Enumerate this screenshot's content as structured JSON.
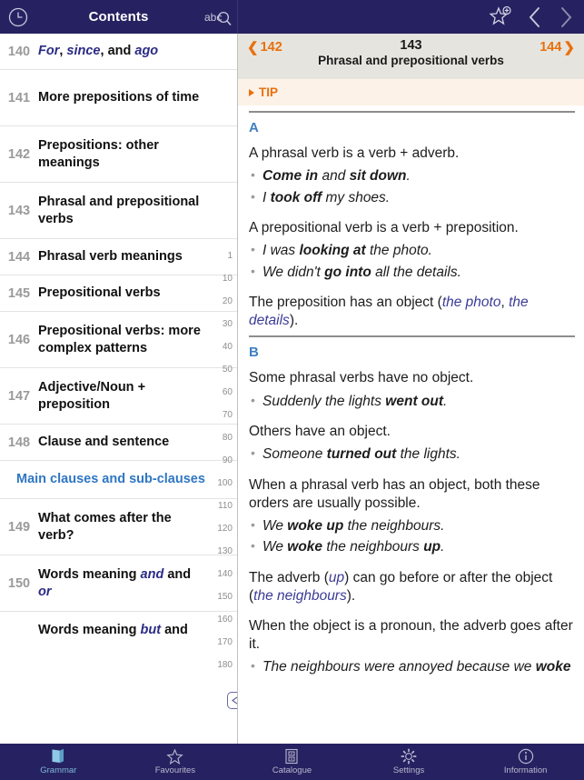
{
  "topbar": {
    "history_icon": "clock-icon",
    "title": "Contents",
    "search_icon": "abc-search-icon",
    "favourite_icon": "star-plus-icon",
    "back_icon": "chevron-left-icon",
    "forward_icon": "chevron-right-icon"
  },
  "sidebar": {
    "items": [
      {
        "num": "140",
        "label": "For, since, and ago",
        "type": "entry",
        "lines": 1,
        "parts": [
          {
            "t": "For",
            "i": true
          },
          {
            "t": ", ",
            "i": false
          },
          {
            "t": "since",
            "i": true
          },
          {
            "t": ", and ",
            "i": false
          },
          {
            "t": "ago",
            "i": true
          }
        ]
      },
      {
        "num": "141",
        "label": "More prepositions of time",
        "type": "entry",
        "lines": 2,
        "parts": [
          {
            "t": "More prepositions of time",
            "i": false
          }
        ]
      },
      {
        "num": "142",
        "label": "Prepositions: other meanings",
        "type": "entry",
        "lines": 2,
        "parts": [
          {
            "t": "Prepositions: other meanings",
            "i": false
          }
        ]
      },
      {
        "num": "143",
        "label": "Phrasal and prepositional verbs",
        "type": "entry",
        "lines": 2,
        "parts": [
          {
            "t": "Phrasal and prepositional verbs",
            "i": false
          }
        ]
      },
      {
        "num": "144",
        "label": "Phrasal verb meanings",
        "type": "entry",
        "lines": 1,
        "parts": [
          {
            "t": "Phrasal verb meanings",
            "i": false
          }
        ]
      },
      {
        "num": "145",
        "label": "Prepositional verbs",
        "type": "entry",
        "lines": 1,
        "parts": [
          {
            "t": "Prepositional verbs",
            "i": false
          }
        ]
      },
      {
        "num": "146",
        "label": "Prepositional verbs: more complex patterns",
        "type": "entry",
        "lines": 2,
        "parts": [
          {
            "t": "Prepositional verbs: more complex patterns",
            "i": false
          }
        ]
      },
      {
        "num": "147",
        "label": "Adjective/Noun + preposition",
        "type": "entry",
        "lines": 2,
        "parts": [
          {
            "t": "Adjective/Noun + preposition",
            "i": false
          }
        ]
      },
      {
        "num": "148",
        "label": "Clause and sentence",
        "type": "entry",
        "lines": 1,
        "parts": [
          {
            "t": "Clause and sentence",
            "i": false
          }
        ]
      },
      {
        "num": "",
        "label": "Main clauses and sub-clauses",
        "type": "section",
        "lines": 1,
        "parts": [
          {
            "t": "Main clauses and sub-clauses",
            "i": false
          }
        ]
      },
      {
        "num": "149",
        "label": "What comes after the verb?",
        "type": "entry",
        "lines": 2,
        "parts": [
          {
            "t": "What comes after the verb?",
            "i": false
          }
        ]
      },
      {
        "num": "150",
        "label": "Words meaning and and or",
        "type": "entry",
        "lines": 2,
        "parts": [
          {
            "t": "Words meaning ",
            "i": false
          },
          {
            "t": "and",
            "i": true
          },
          {
            "t": " and ",
            "i": false
          },
          {
            "t": "or",
            "i": true
          }
        ]
      },
      {
        "num": "",
        "label": "Words meaning but and",
        "type": "entry",
        "lines": 1,
        "clipped": true,
        "parts": [
          {
            "t": "Words meaning ",
            "i": false
          },
          {
            "t": "but",
            "i": true
          },
          {
            "t": " and",
            "i": false
          }
        ]
      }
    ],
    "index_marks": [
      "1",
      "10",
      "20",
      "30",
      "40",
      "50",
      "60",
      "70",
      "80",
      "90",
      "100",
      "110",
      "120",
      "130",
      "140",
      "150",
      "160",
      "170",
      "180"
    ],
    "splitter_icon": "resize-handle-icon"
  },
  "page": {
    "prev_label": "142",
    "next_label": "144",
    "number": "143",
    "title": "Phrasal and prepositional verbs",
    "tip_label": "TIP",
    "sections": [
      {
        "letter": "A",
        "blocks": [
          {
            "kind": "para",
            "parts": [
              {
                "t": "A phrasal verb is a verb + adverb.",
                "s": "n"
              }
            ]
          },
          {
            "kind": "list",
            "items": [
              [
                {
                  "t": "Come in",
                  "s": "b"
                },
                {
                  "t": " and ",
                  "s": "i"
                },
                {
                  "t": "sit down",
                  "s": "b"
                },
                {
                  "t": ".",
                  "s": "i"
                }
              ],
              [
                {
                  "t": "I ",
                  "s": "i"
                },
                {
                  "t": "took off",
                  "s": "b"
                },
                {
                  "t": " my shoes.",
                  "s": "i"
                }
              ]
            ]
          },
          {
            "kind": "para",
            "gap": true,
            "parts": [
              {
                "t": "A prepositional verb is a verb + preposition.",
                "s": "n"
              }
            ]
          },
          {
            "kind": "list",
            "items": [
              [
                {
                  "t": "I was ",
                  "s": "i"
                },
                {
                  "t": "looking at",
                  "s": "b"
                },
                {
                  "t": " the photo.",
                  "s": "i"
                }
              ],
              [
                {
                  "t": "We didn't ",
                  "s": "i"
                },
                {
                  "t": "go into",
                  "s": "b"
                },
                {
                  "t": " all the details.",
                  "s": "i"
                }
              ]
            ]
          },
          {
            "kind": "para",
            "gap": true,
            "parts": [
              {
                "t": "The preposition has an object (",
                "s": "n"
              },
              {
                "t": "the photo",
                "s": "bl"
              },
              {
                "t": ", ",
                "s": "n"
              },
              {
                "t": "the details",
                "s": "bl"
              },
              {
                "t": ").",
                "s": "n"
              }
            ]
          }
        ]
      },
      {
        "letter": "B",
        "blocks": [
          {
            "kind": "para",
            "parts": [
              {
                "t": "Some phrasal verbs have no object.",
                "s": "n"
              }
            ]
          },
          {
            "kind": "list",
            "items": [
              [
                {
                  "t": "Suddenly the lights ",
                  "s": "i"
                },
                {
                  "t": "went out",
                  "s": "b"
                },
                {
                  "t": ".",
                  "s": "i"
                }
              ]
            ]
          },
          {
            "kind": "para",
            "gap": true,
            "parts": [
              {
                "t": "Others have an object.",
                "s": "n"
              }
            ]
          },
          {
            "kind": "list",
            "items": [
              [
                {
                  "t": "Someone ",
                  "s": "i"
                },
                {
                  "t": "turned out",
                  "s": "b"
                },
                {
                  "t": " the lights.",
                  "s": "i"
                }
              ]
            ]
          },
          {
            "kind": "para",
            "gap": true,
            "parts": [
              {
                "t": "When a phrasal verb has an object, both these orders are usually possible.",
                "s": "n"
              }
            ]
          },
          {
            "kind": "list",
            "items": [
              [
                {
                  "t": "We ",
                  "s": "i"
                },
                {
                  "t": "woke up",
                  "s": "b"
                },
                {
                  "t": " the neighbours.",
                  "s": "i"
                }
              ],
              [
                {
                  "t": "We ",
                  "s": "i"
                },
                {
                  "t": "woke",
                  "s": "b"
                },
                {
                  "t": " the neighbours ",
                  "s": "i"
                },
                {
                  "t": "up",
                  "s": "b"
                },
                {
                  "t": ".",
                  "s": "i"
                }
              ]
            ]
          },
          {
            "kind": "para",
            "gap": true,
            "parts": [
              {
                "t": "The adverb (",
                "s": "n"
              },
              {
                "t": "up",
                "s": "bl"
              },
              {
                "t": ") can go before or after the object (",
                "s": "n"
              },
              {
                "t": "the neighbours",
                "s": "bl"
              },
              {
                "t": ").",
                "s": "n"
              }
            ]
          },
          {
            "kind": "para",
            "gap": true,
            "parts": [
              {
                "t": "When the object is a pronoun, the adverb goes after it.",
                "s": "n"
              }
            ]
          },
          {
            "kind": "list",
            "items": [
              [
                {
                  "t": "The neighbours were annoyed because we ",
                  "s": "i"
                },
                {
                  "t": "woke",
                  "s": "b"
                }
              ]
            ]
          }
        ]
      }
    ]
  },
  "tabs": [
    {
      "label": "Grammar",
      "icon": "book-icon",
      "active": true
    },
    {
      "label": "Favourites",
      "icon": "star-icon",
      "active": false
    },
    {
      "label": "Catalogue",
      "icon": "cabinet-icon",
      "active": false
    },
    {
      "label": "Settings",
      "icon": "gear-icon",
      "active": false
    },
    {
      "label": "Information",
      "icon": "info-icon",
      "active": false
    }
  ],
  "colors": {
    "navy": "#262261",
    "accent_orange": "#e8700d",
    "link_blue": "#3b3b96",
    "section_blue": "#2f76c4",
    "active_tab": "#7fb8d8",
    "head_grey": "#e6e4de",
    "tip_bg": "#fdf2e7"
  }
}
